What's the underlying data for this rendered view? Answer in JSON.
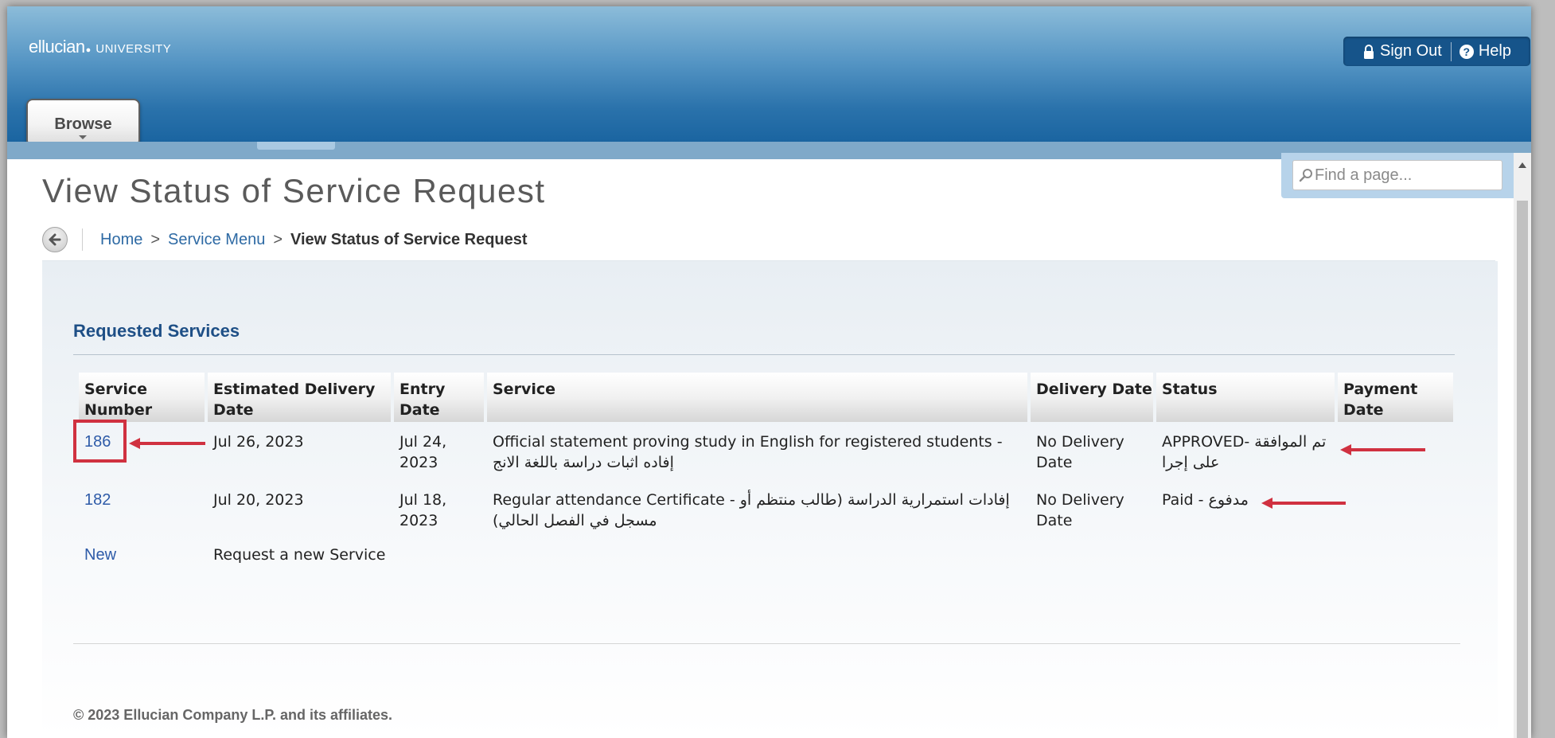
{
  "header": {
    "logo_main": "ellucian",
    "logo_dot": "●",
    "logo_sub": "UNIVERSITY",
    "sign_out": "Sign Out",
    "help": "Help",
    "help_glyph": "?",
    "browse": "Browse"
  },
  "search": {
    "placeholder": "Find a page..."
  },
  "page": {
    "title": "View Status of Service Request"
  },
  "breadcrumb": {
    "items": [
      "Home",
      "Service Menu"
    ],
    "separator": ">",
    "current": "View Status of Service Request"
  },
  "section": {
    "title": "Requested Services"
  },
  "table": {
    "columns": [
      "Service\nNumber",
      "Estimated Delivery\nDate",
      "Entry\nDate",
      "Service",
      "Delivery Date",
      "Status",
      "Payment\nDate"
    ],
    "rows": [
      {
        "number": "186",
        "estimated": "Jul 26, 2023",
        "entry": "Jul 24,\n2023",
        "service_en": "Official statement proving study in English for registered students - ",
        "service_ar": "إفاده اثبات دراسة باللغة الانج",
        "delivery": "No Delivery\nDate",
        "status_en": "APPROVED- ",
        "status_ar": "تم الموافقة على إجرا",
        "payment": ""
      },
      {
        "number": "182",
        "estimated": "Jul 20, 2023",
        "entry": "Jul 18,\n2023",
        "service_en": "Regular attendance Certificate - ",
        "service_ar": "إفادات استمرارية الدراسة (طالب منتظم أو مسجل في الفصل الحالي)",
        "delivery": "No Delivery\nDate",
        "status_en": "Paid - ",
        "status_ar": "مدفوع",
        "payment": ""
      }
    ],
    "new_row": {
      "link": "New",
      "text": "Request a new Service"
    }
  },
  "footer": {
    "copyright": "© 2023 Ellucian Company L.P. and its affiliates."
  },
  "annotations": {
    "color": "#d03140"
  },
  "colors": {
    "header_blue": "#2a72ab",
    "link": "#2e5ba8",
    "section_title": "#1e4f86"
  }
}
